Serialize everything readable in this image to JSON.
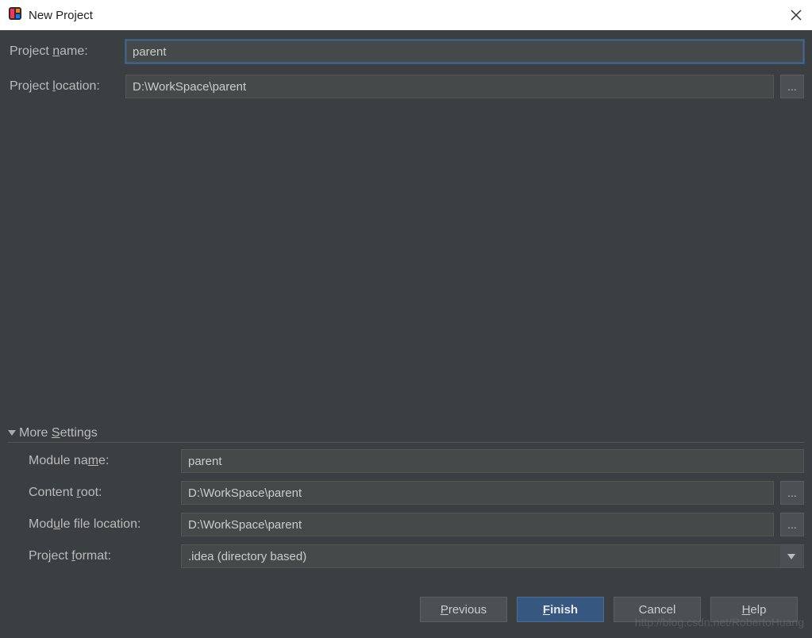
{
  "window": {
    "title": "New Project"
  },
  "top": {
    "project_name_label": "Project name:",
    "project_name_underline": 8,
    "project_name_value": "parent",
    "project_location_label": "Project location:",
    "project_location_underline": 8,
    "project_location_value": "D:\\WorkSpace\\parent"
  },
  "more": {
    "header": "More Settings",
    "header_underline": 5,
    "module_name_label": "Module name:",
    "module_name_underline": 9,
    "module_name_value": "parent",
    "content_root_label": "Content root:",
    "content_root_underline": 8,
    "content_root_value": "D:\\WorkSpace\\parent",
    "module_file_location_label": "Module file location:",
    "module_file_location_underline": 3,
    "module_file_location_value": "D:\\WorkSpace\\parent",
    "project_format_label": "Project format:",
    "project_format_underline": 8,
    "project_format_value": ".idea (directory based)"
  },
  "buttons": {
    "previous": "Previous",
    "previous_underline": 0,
    "finish": "Finish",
    "finish_underline": 0,
    "cancel": "Cancel",
    "help": "Help",
    "help_underline": 0
  },
  "browse_label": "...",
  "watermark": "http://blog.csdn.net/RobertoHuang"
}
